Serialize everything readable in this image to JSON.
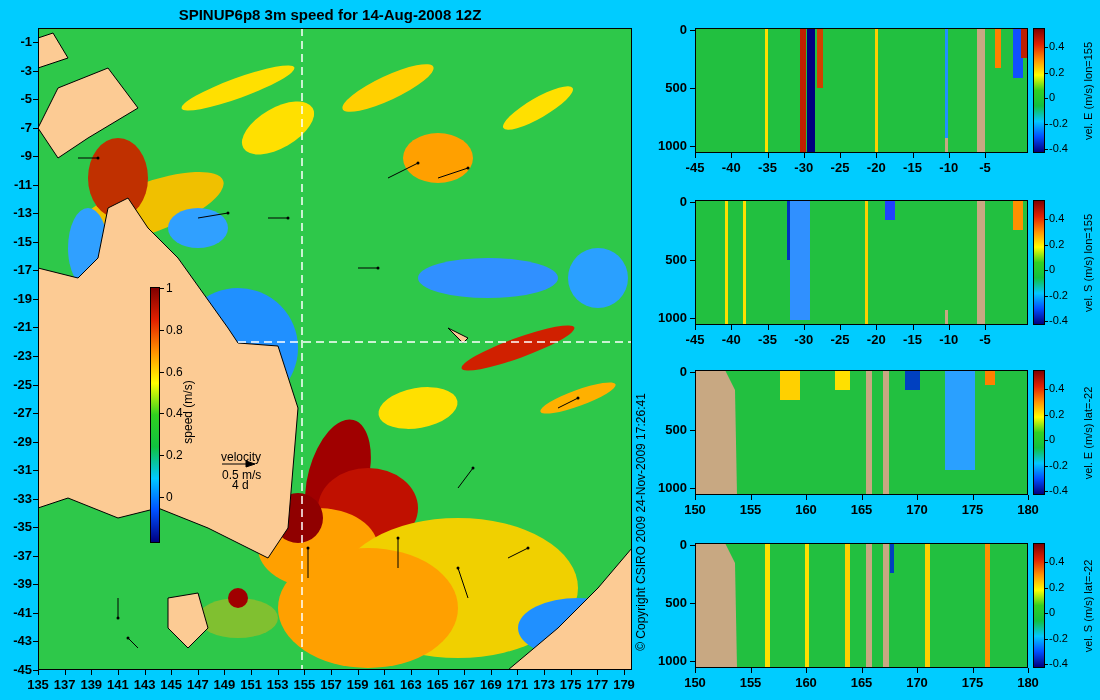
{
  "title": "SPINUP6p8 3m speed for 14-Aug-2008 12Z",
  "map": {
    "y_ticks": [
      "-1",
      "-3",
      "-5",
      "-7",
      "-9",
      "-11",
      "-13",
      "-15",
      "-17",
      "-19",
      "-21",
      "-23",
      "-25",
      "-27",
      "-29",
      "-31",
      "-33",
      "-35",
      "-37",
      "-39",
      "-41",
      "-43",
      "-45"
    ],
    "x_ticks": [
      "135",
      "137",
      "139",
      "141",
      "143",
      "145",
      "147",
      "149",
      "151",
      "153",
      "155",
      "157",
      "159",
      "161",
      "163",
      "165",
      "167",
      "169",
      "171",
      "173",
      "175",
      "177",
      "179"
    ],
    "colorbar": {
      "label": "speed (m/s)",
      "ticks": [
        "1",
        "0.8",
        "0.6",
        "0.4",
        "0.2",
        "0"
      ]
    },
    "legend": {
      "title": "velocity",
      "speed": "0.5 m/s",
      "duration": "4 d"
    },
    "copyright": "© Copyright CSIRO 2009   24-Nov-2009 17:26:41"
  },
  "sections": [
    {
      "kind": "lon_section",
      "label": "vel. E (m/s) lon=155",
      "y_ticks": [
        "0",
        "500",
        "1000"
      ],
      "x_ticks": [
        "-45",
        "-40",
        "-35",
        "-30",
        "-25",
        "-20",
        "-15",
        "-10",
        "-5"
      ],
      "colorbar_ticks": [
        "0.4",
        "0.2",
        "0",
        "-0.2",
        "-0.4"
      ]
    },
    {
      "kind": "lon_section",
      "label": "vel. S (m/s) lon=155",
      "y_ticks": [
        "0",
        "500",
        "1000"
      ],
      "x_ticks": [
        "-45",
        "-40",
        "-35",
        "-30",
        "-25",
        "-20",
        "-15",
        "-10",
        "-5"
      ],
      "colorbar_ticks": [
        "0.4",
        "0.2",
        "0",
        "-0.2",
        "-0.4"
      ]
    },
    {
      "kind": "lat_section",
      "label": "vel. E (m/s) lat=-22",
      "y_ticks": [
        "0",
        "500",
        "1000"
      ],
      "x_ticks": [
        "150",
        "155",
        "160",
        "165",
        "170",
        "175",
        "180"
      ],
      "colorbar_ticks": [
        "0.4",
        "0.2",
        "0",
        "-0.2",
        "-0.4"
      ]
    },
    {
      "kind": "lat_section",
      "label": "vel. S (m/s) lat=-22",
      "y_ticks": [
        "0",
        "500",
        "1000"
      ],
      "x_ticks": [
        "150",
        "155",
        "160",
        "165",
        "170",
        "175",
        "180"
      ],
      "colorbar_ticks": [
        "0.4",
        "0.2",
        "0",
        "-0.2",
        "-0.4"
      ]
    }
  ]
}
